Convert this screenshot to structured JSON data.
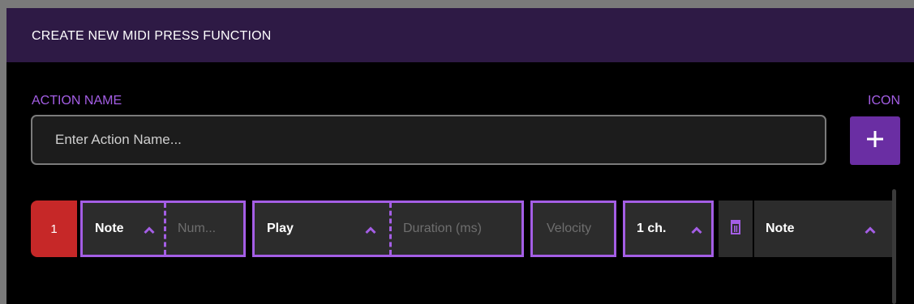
{
  "header": {
    "title": "CREATE NEW MIDI PRESS FUNCTION"
  },
  "form": {
    "action_name_label": "ACTION NAME",
    "action_name_placeholder": "Enter Action Name...",
    "action_name_value": "",
    "icon_label": "ICON",
    "add_icon_glyph": "plus-icon"
  },
  "step": {
    "index": "1",
    "type_select": "Note",
    "number_placeholder": "Num...",
    "mode_select": "Play",
    "duration_placeholder": "Duration (ms)",
    "velocity_placeholder": "Velocity",
    "channel_select": "1 ch.",
    "delete_icon": "trash-icon",
    "extra_select": "Note"
  },
  "colors": {
    "accent": "#a45ee5",
    "header_bg": "#2e1a45",
    "add_button": "#6a2ea3",
    "step_index": "#c62828"
  }
}
